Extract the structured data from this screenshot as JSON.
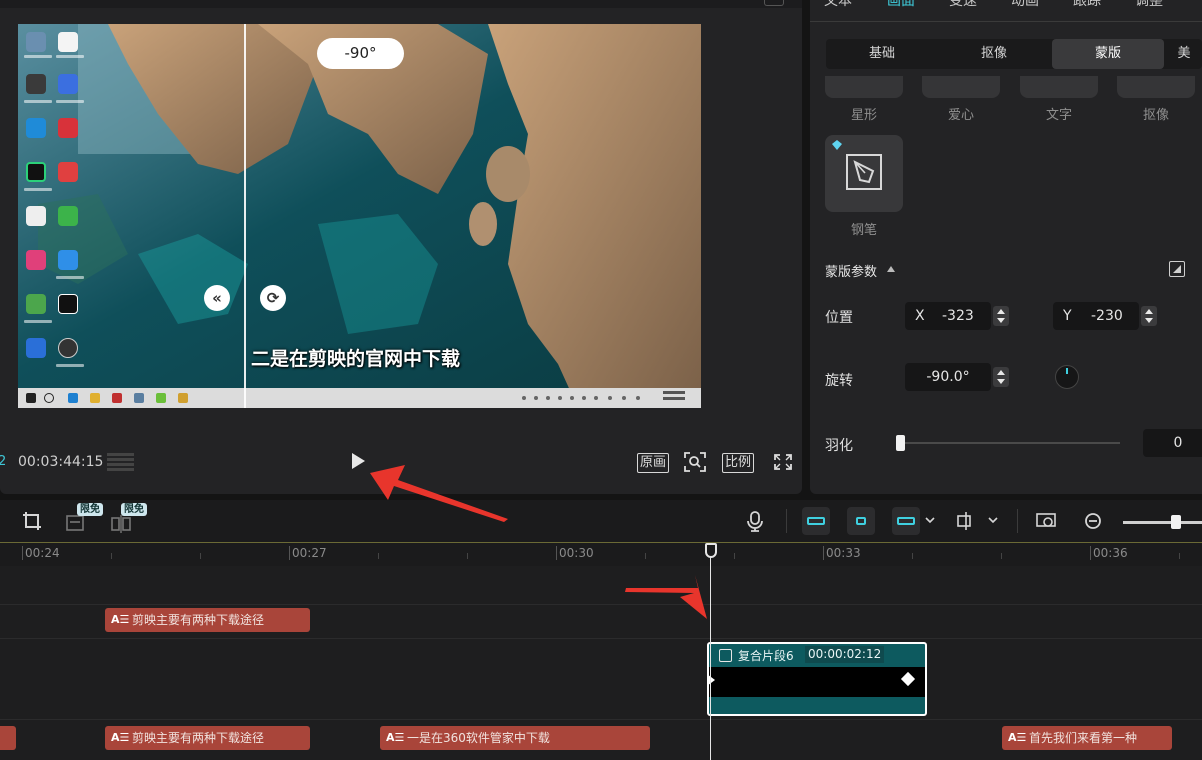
{
  "player": {
    "preview": {
      "angle_badge": "-90°",
      "subtitle": "二是在剪映的官网中下载"
    },
    "controls": {
      "current_time": "00:03:44:15",
      "original_label": "原画",
      "ratio_label": "比例"
    }
  },
  "inspector": {
    "top_tabs": [
      "文本",
      "画面",
      "变速",
      "动画",
      "跟踪",
      "调整"
    ],
    "active_top_tab": "画面",
    "sub_tabs": [
      "基础",
      "抠像",
      "蒙版",
      "美"
    ],
    "active_sub_tab": "蒙版",
    "mask_shapes": [
      "星形",
      "爱心",
      "文字",
      "抠像"
    ],
    "pen_label": "钢笔",
    "params": {
      "title": "蒙版参数",
      "position_label": "位置",
      "x_axis": "X",
      "x_value": "-323",
      "y_axis": "Y",
      "y_value": "-230",
      "rotation_label": "旋转",
      "rotation_value": "-90.0°",
      "feather_label": "羽化",
      "feather_value": "0",
      "feather_level": 0
    }
  },
  "timeline": {
    "toolbar": {
      "free_badge": "限免"
    },
    "ruler": [
      "00:24",
      "00:27",
      "00:30",
      "00:33",
      "00:36"
    ],
    "text_track_top": [
      {
        "text": "剪映主要有两种下载途径"
      }
    ],
    "compound_clip": {
      "title": "复合片段6",
      "duration": "00:00:02:12"
    },
    "text_track_bottom": [
      {
        "text": "剪映主要有两种下载途径"
      },
      {
        "text": "一是在360软件管家中下载"
      },
      {
        "text": "首先我们来看第一种"
      }
    ]
  },
  "colors": {
    "accent": "#3fd0e0",
    "caption_clip": "#a9453a",
    "compound_clip": "#0d5a5f",
    "annotation_arrow": "#e8352c"
  }
}
